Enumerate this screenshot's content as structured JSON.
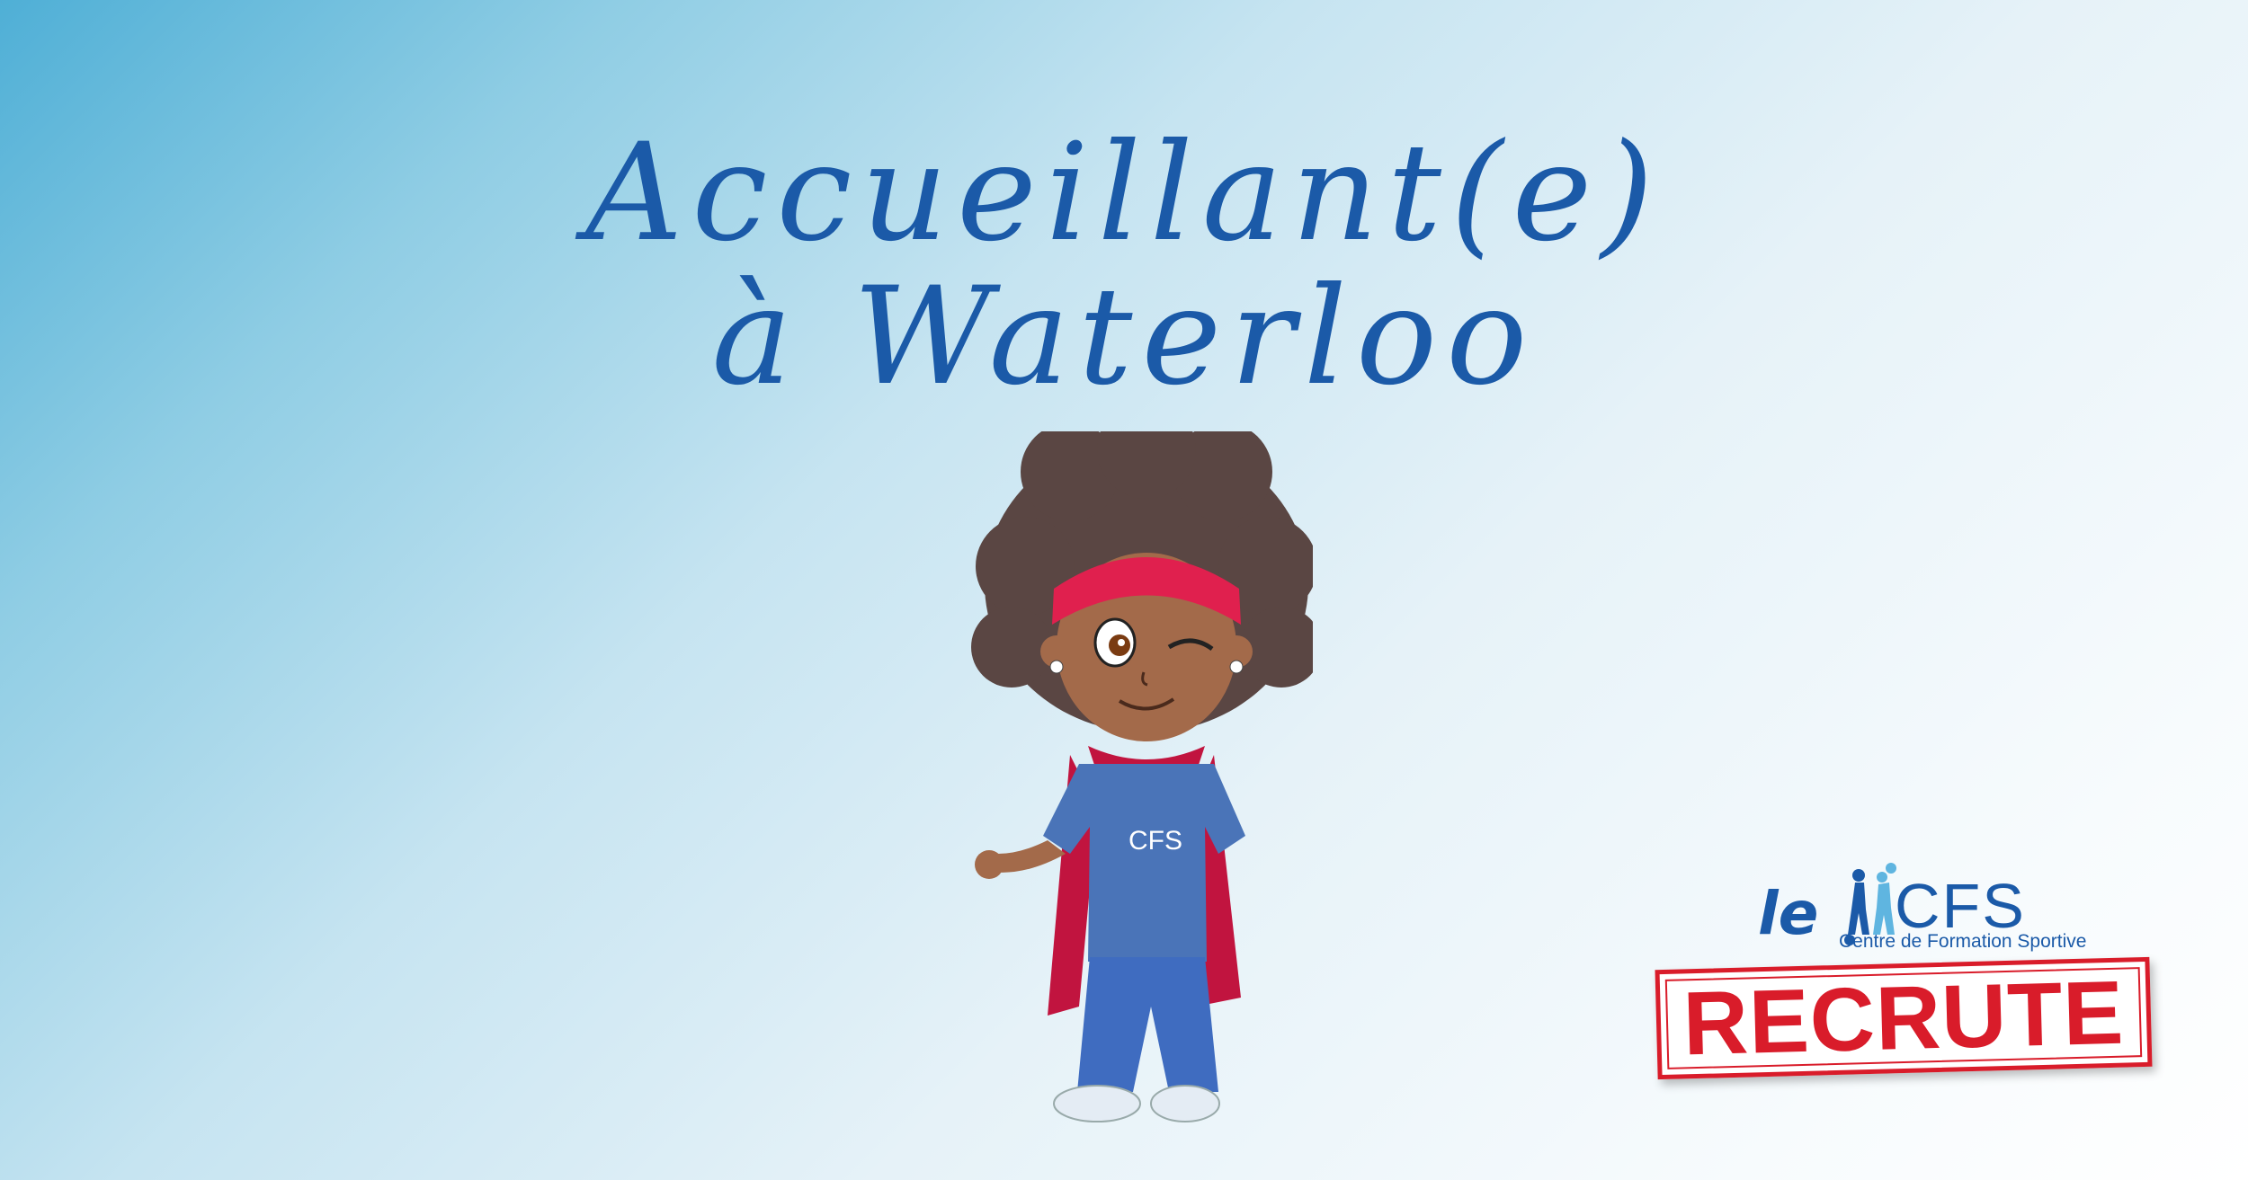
{
  "headline": {
    "line1": "Accueillant(e)",
    "line2": "à Waterloo"
  },
  "mascot": {
    "shirt_text": "CFS"
  },
  "logo": {
    "prefix": "le",
    "brand": "CFS",
    "tagline": "Centre de Formation Sportive"
  },
  "stamp": {
    "label": "RECRUTE"
  },
  "colors": {
    "brand_blue": "#1b5aa8",
    "stamp_red": "#d91c2a",
    "sky_gradient_start": "#4fafd6"
  }
}
